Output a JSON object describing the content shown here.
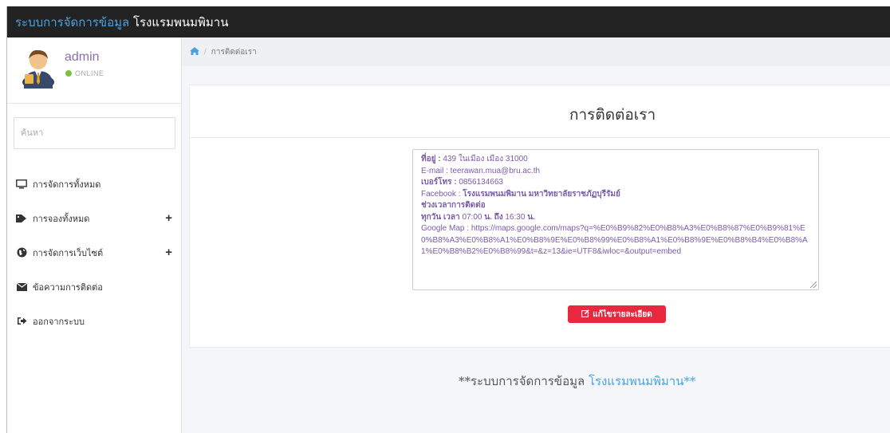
{
  "header": {
    "brand_part1": "ระบบการจัดการข้อมูล",
    "brand_part2": "โรงแรมพนมพิมาน"
  },
  "user": {
    "name": "admin",
    "status": "ONLINE",
    "status_color": "#7bc043"
  },
  "sidebar": {
    "search_placeholder": "ค้นหา",
    "items": [
      {
        "label": "การจัดการทั้งหมด",
        "icon": "monitor-icon",
        "expandable": false
      },
      {
        "label": "การจองทั้งหมด",
        "icon": "tag-icon",
        "expandable": true
      },
      {
        "label": "การจัดการเว็บไซต์",
        "icon": "globe-icon",
        "expandable": true
      },
      {
        "label": "ข้อความการติดต่อ",
        "icon": "envelope-icon",
        "expandable": false
      },
      {
        "label": "ออกจากระบบ",
        "icon": "sign-out-icon",
        "expandable": false
      }
    ],
    "plus_symbol": "+"
  },
  "breadcrumb": {
    "home_icon": "home-icon",
    "separator": "/",
    "current": "การติดต่อเรา"
  },
  "card": {
    "title": "การติดต่อเรา",
    "contact": {
      "address_label": "ที่อยู่ :",
      "address_value": "439 ในเมือง เมือง 31000",
      "email_line": "E-mail : teerawan.mua@bru.ac.th",
      "phone_label": "เบอร์โทร :",
      "phone_value": "0856134663",
      "facebook_label": "Facebook :",
      "facebook_value": "โรงแรมพนมพิมาน มหาวิทยาลัยราชภัฏบุรีรัมย์",
      "hours_heading": "ช่วงเวลาการติดต่อ",
      "hours_label": "ทุกวัน เวลา",
      "hours_from": "07:00",
      "hours_u1": "น.",
      "hours_to_label": "ถึง",
      "hours_to": "16:30",
      "hours_u2": "น.",
      "map_line": "Google Map : https://maps.google.com/maps?q=%E0%B9%82%E0%B8%A3%E0%B8%87%E0%B9%81%E0%B8%A3%E0%B8%A1%E0%B8%9E%E0%B8%99%E0%B8%A1%E0%B8%9E%E0%B8%B4%E0%B8%A1%E0%B8%B2%E0%B8%99&t=&z=13&ie=UTF8&iwloc=&output=embed"
    },
    "edit_button": "แก้ไขรายละเอียด",
    "edit_button_color": "#e8283f"
  },
  "footer": {
    "prefix": "**ระบบการจัดการข้อมูล",
    "highlight": "โรงแรมพนมพิมาน**"
  }
}
